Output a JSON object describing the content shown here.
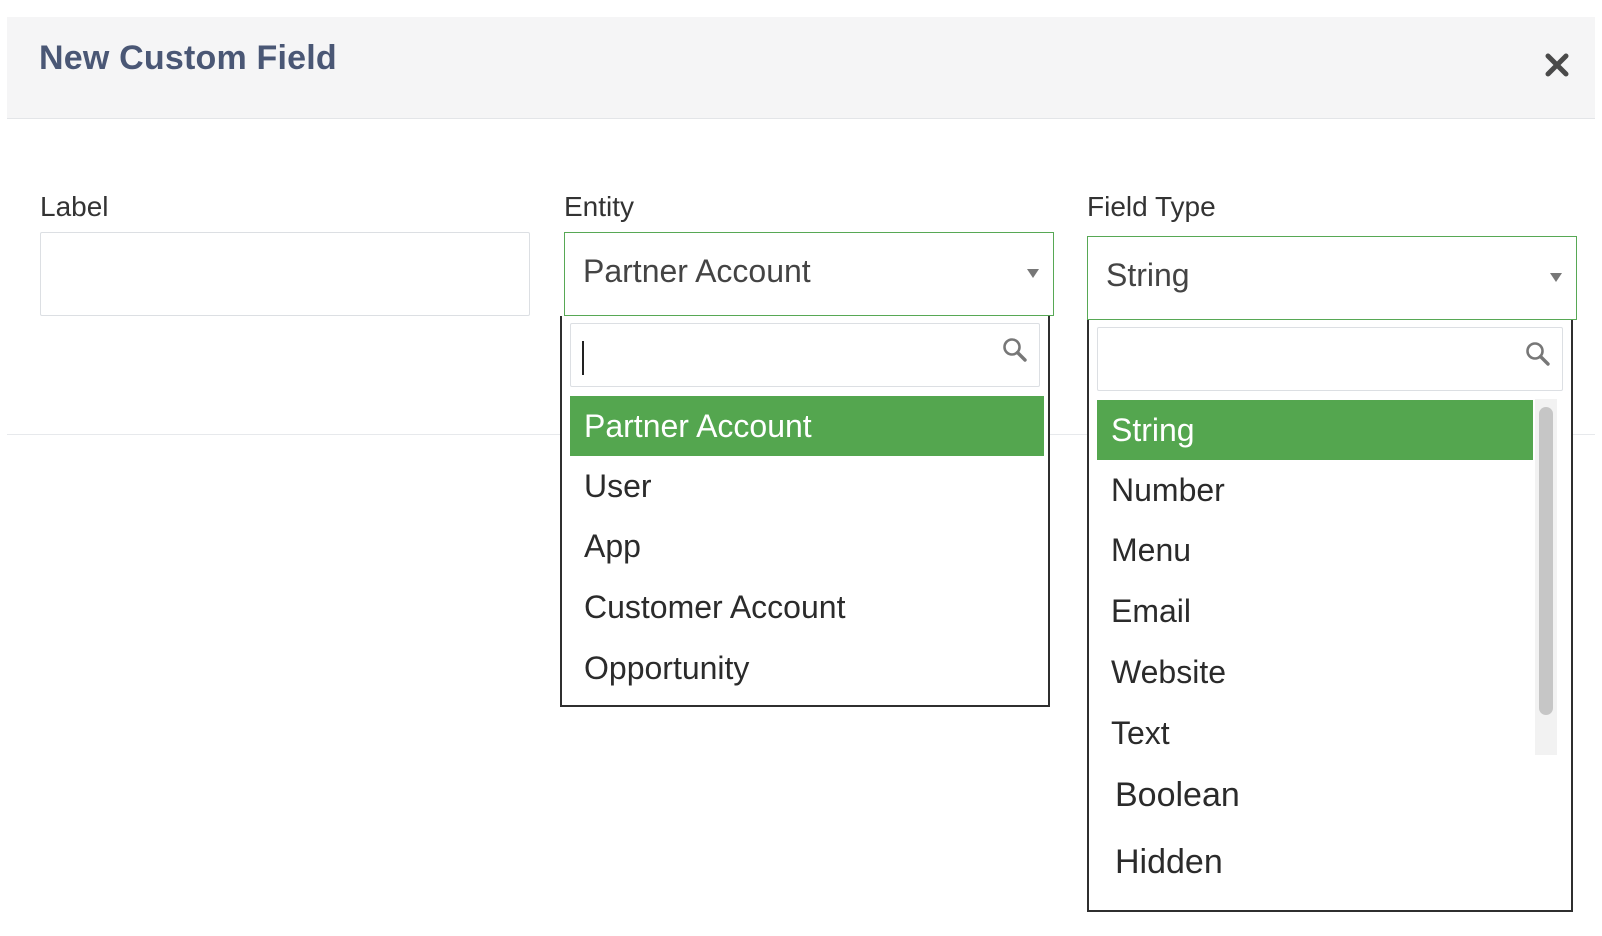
{
  "modal": {
    "title": "New Custom Field"
  },
  "form": {
    "label_field": {
      "label": "Label",
      "value": "",
      "placeholder": ""
    },
    "entity_field": {
      "label": "Entity",
      "selected": "Partner Account"
    },
    "field_type_field": {
      "label": "Field Type",
      "selected": "String"
    }
  },
  "entity_dropdown": {
    "search_value": "",
    "options": [
      "Partner Account",
      "User",
      "App",
      "Customer Account",
      "Opportunity"
    ],
    "selected_index": 0
  },
  "field_type_dropdown": {
    "search_value": "",
    "options": [
      "String",
      "Number",
      "Menu",
      "Email",
      "Website",
      "Text",
      "Boolean",
      "Hidden"
    ],
    "selected_index": 0
  },
  "icons": {
    "close": "close-icon",
    "search": "search-icon",
    "dropdown_arrow": "chevron-down-icon"
  },
  "colors": {
    "accent_green": "#54a64f",
    "title_color": "#4a5775",
    "header_bg": "#f5f5f6"
  }
}
